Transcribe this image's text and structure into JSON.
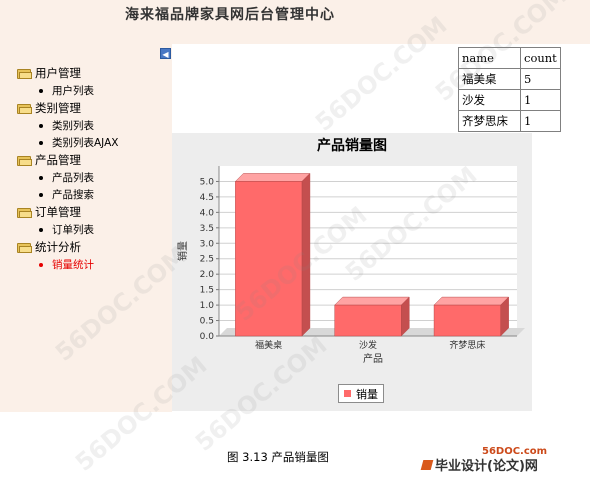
{
  "header": {
    "title": "海来福品牌家具网后台管理中心"
  },
  "sidebar": {
    "groups": [
      {
        "label": "用户管理",
        "items": [
          {
            "label": "用户列表"
          }
        ]
      },
      {
        "label": "类别管理",
        "items": [
          {
            "label": "类别列表"
          },
          {
            "label": "类别列表AJAX"
          }
        ]
      },
      {
        "label": "产品管理",
        "items": [
          {
            "label": "产品列表"
          },
          {
            "label": "产品搜索"
          }
        ]
      },
      {
        "label": "订单管理",
        "items": [
          {
            "label": "订单列表"
          }
        ]
      },
      {
        "label": "统计分析",
        "items": [
          {
            "label": "销量统计",
            "active": true
          }
        ]
      }
    ]
  },
  "count_table": {
    "headers": [
      "name",
      "count"
    ],
    "rows": [
      [
        "福美桌",
        "5"
      ],
      [
        "沙发",
        "1"
      ],
      [
        "齐梦思床",
        "1"
      ]
    ]
  },
  "chart_data": {
    "type": "bar",
    "title": "产品销量图",
    "xlabel": "产品",
    "ylabel": "销量",
    "categories": [
      "福美桌",
      "沙发",
      "齐梦思床"
    ],
    "series": [
      {
        "name": "销量",
        "values": [
          5,
          1,
          1
        ]
      }
    ],
    "ylim": [
      0,
      5.5
    ],
    "yticks": [
      "0.0",
      "0.5",
      "1.0",
      "1.5",
      "2.0",
      "2.5",
      "3.0",
      "3.5",
      "4.0",
      "4.5",
      "5.0"
    ],
    "grid": true,
    "legend": "bottom",
    "bar_color": "#ff6a6a"
  },
  "caption": "图 3.13  产品销量图",
  "footer": {
    "site": "56DOC.com",
    "logo_text": "毕业设计(论文)网"
  },
  "watermark": "56DOC.COM"
}
